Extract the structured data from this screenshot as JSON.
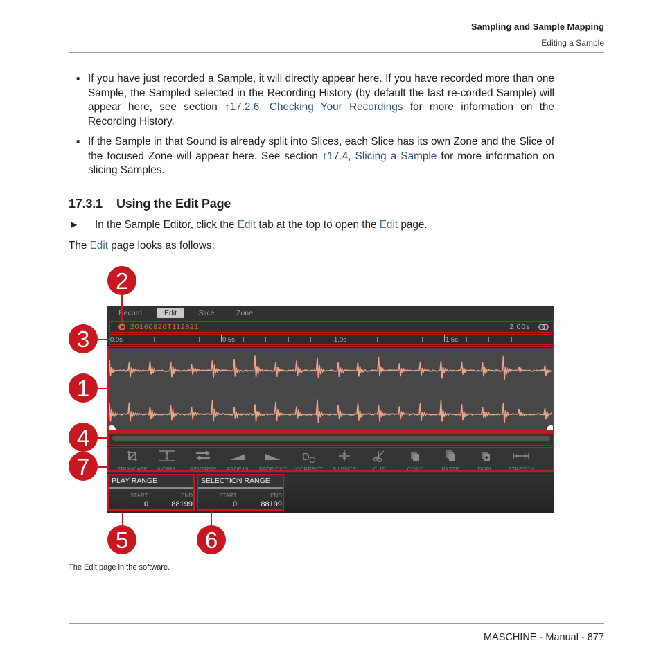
{
  "header": {
    "chapter": "Sampling and Sample Mapping",
    "section": "Editing a Sample"
  },
  "bullets": [
    {
      "before": "If you have just recorded a Sample, it will directly appear here. If you have recorded more than one Sample, the Sampled selected in the Recording History (by default the last re-corded Sample) will appear here, see section ",
      "link": "↑17.2.6, Checking Your Recordings",
      "after": " for more information on the Recording History."
    },
    {
      "before": "If the Sample in that Sound is already split into Slices, each Slice has its own Zone and the Slice of the focused Zone will appear here. See section ",
      "link": "↑17.4, Slicing a Sample",
      "after": " for more information on slicing Samples."
    }
  ],
  "section_heading": {
    "number": "17.3.1",
    "title": "Using the Edit Page"
  },
  "instruction": {
    "arrow": "►",
    "part1": "In the Sample Editor, click the ",
    "kw1": "Edit",
    "part2": " tab at the top to open the ",
    "kw2": "Edit",
    "part3": " page."
  },
  "intro": {
    "part1": "The ",
    "kw": "Edit",
    "part2": " page looks as follows:"
  },
  "editor": {
    "tabs": [
      "Record",
      "Edit",
      "Slice",
      "Zone"
    ],
    "active_tab": "Edit",
    "sample_name": "20160826T112821",
    "duration": "2.00s",
    "ruler_labels": [
      "0.0s",
      "0.5s",
      "1.0s",
      "1.5s"
    ],
    "waveform_color": "#f0a487",
    "tools": [
      {
        "label": "TRUNCATE",
        "icon": "truncate-icon"
      },
      {
        "label": "NORM.",
        "icon": "normalize-icon"
      },
      {
        "label": "REVERSE",
        "icon": "reverse-icon"
      },
      {
        "label": "FADE IN",
        "icon": "fade-in-icon"
      },
      {
        "label": "FADE OUT",
        "icon": "fade-out-icon"
      },
      {
        "label": "CORRECT",
        "icon": "dc-correct-icon"
      },
      {
        "label": "SILENCE",
        "icon": "silence-icon"
      },
      {
        "label": "CUT",
        "icon": "scissors-icon"
      },
      {
        "label": "COPY",
        "icon": "copy-icon"
      },
      {
        "label": "PASTE",
        "icon": "paste-icon"
      },
      {
        "label": "DUPL.",
        "icon": "duplicate-icon"
      },
      {
        "label": "STRETCH",
        "icon": "stretch-icon"
      }
    ],
    "play_range": {
      "title": "PLAY RANGE",
      "start_label": "START",
      "end_label": "END",
      "start": "0",
      "end": "88199"
    },
    "selection_range": {
      "title": "SELECTION RANGE",
      "start_label": "START",
      "end_label": "END",
      "start": "0",
      "end": "88199"
    }
  },
  "callouts": [
    "1",
    "2",
    "3",
    "4",
    "5",
    "6",
    "7"
  ],
  "caption": "The Edit page in the software.",
  "footer": "MASCHINE - Manual - 877",
  "colors": {
    "annotation_red": "#c8171e",
    "link_blue": "#27507e",
    "sample_orange": "#e8683a"
  }
}
